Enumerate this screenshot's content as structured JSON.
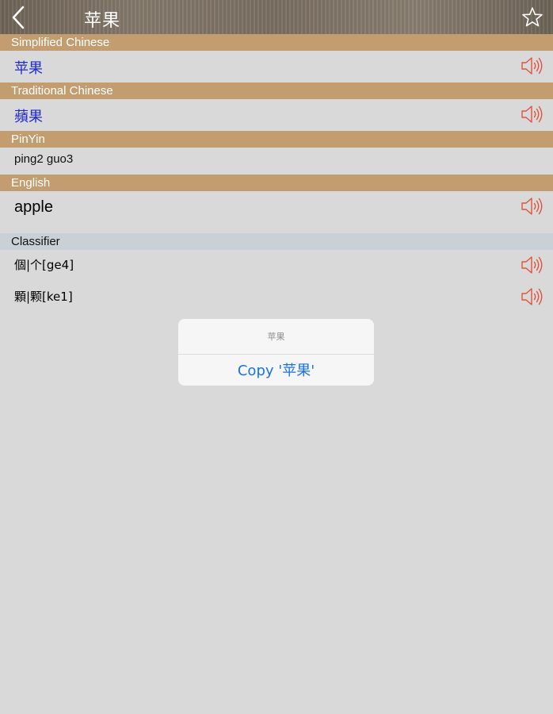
{
  "nav": {
    "title": "苹果",
    "back_icon": "chevron-left-icon",
    "favorite_icon": "star-outline-icon"
  },
  "sections": {
    "simplified": {
      "header": "Simplified Chinese",
      "value": "苹果"
    },
    "traditional": {
      "header": "Traditional Chinese",
      "value": "蘋果"
    },
    "pinyin": {
      "header": "PinYin",
      "value": "ping2 guo3"
    },
    "english": {
      "header": "English",
      "value": "apple"
    },
    "classifier": {
      "header": "Classifier",
      "items": [
        "個|个[ge4]",
        "顆|颗[ke1]"
      ]
    }
  },
  "popup": {
    "title": "苹果",
    "action_label": "Copy '苹果'"
  },
  "colors": {
    "section_header": "#c39d6f",
    "chinese_text": "#1f2bd0",
    "speaker_icon": "#e0533a",
    "popup_action": "#1a73e8"
  }
}
